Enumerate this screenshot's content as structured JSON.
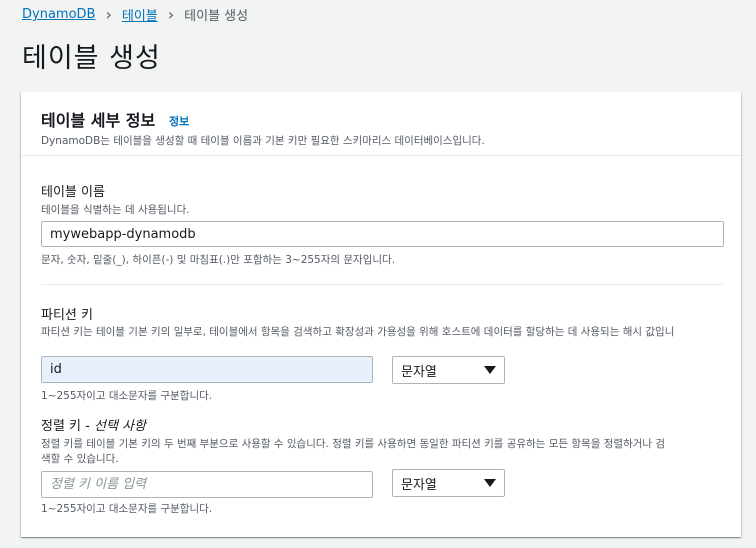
{
  "breadcrumb": {
    "items": [
      {
        "label": "DynamoDB"
      },
      {
        "label": "테이블"
      }
    ],
    "current": "테이블 생성"
  },
  "page_title": "테이블 생성",
  "panel": {
    "title": "테이블 세부 정보",
    "info_link": "정보",
    "description": "DynamoDB는 테이블을 생성할 때 테이블 이름과 기본 키만 필요한 스키마리스 데이터베이스입니다."
  },
  "table_name": {
    "label": "테이블 이름",
    "description": "테이블을 식별하는 데 사용됩니다.",
    "value": "mywebapp-dynamodb",
    "constraint": "문자, 숫자, 밑줄(_), 하이픈(-) 및 마침표(.)만 포함하는 3~255자의 문자입니다."
  },
  "partition_key": {
    "label": "파티션 키",
    "description": "파티션 키는 테이블 기본 키의 일부로, 테이블에서 항목을 검색하고 확장성과 가용성을 위해 호스트에 데이터를 할당하는 데 사용되는 해시 값입니",
    "value": "id",
    "type": "문자열",
    "constraint": "1~255자이고 대소문자를 구분합니다."
  },
  "sort_key": {
    "label": "정렬 키",
    "optional": "- 선택 사항",
    "description_line1": "정렬 키를 테이블 기본 키의 두 번째 부분으로 사용할 수 있습니다. 정렬 키를 사용하면 동일한 파티션 키를 공유하는 모든 항목을 정렬하거나 검",
    "description_line2": "색할 수 있습니다.",
    "placeholder": "정렬 키 이름 입력",
    "type": "문자열",
    "constraint": "1~255자이고 대소문자를 구분합니다."
  },
  "colors": {
    "link": "#0073bb",
    "border": "#aab7b8",
    "autofill": "#e8f0fe"
  },
  "icons": [
    "chevron-right-icon",
    "caret-down-icon"
  ]
}
